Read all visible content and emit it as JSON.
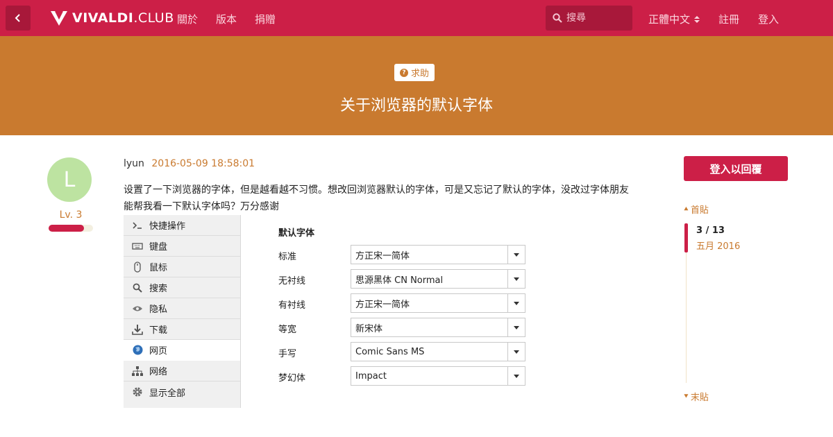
{
  "header": {
    "logo_brand": "VIVALDI",
    "logo_suffix": ".CLUB",
    "nav": [
      "關於",
      "版本",
      "捐贈"
    ],
    "search_placeholder": "搜尋",
    "language": "正體中文",
    "register": "註冊",
    "login": "登入",
    "colors": {
      "bar": "#cc1f47",
      "banner": "#c97a2f"
    }
  },
  "topic": {
    "category": "求助",
    "title": "关于浏览器的默认字体"
  },
  "post": {
    "avatar_letter": "L",
    "level": "Lv. 3",
    "level_progress": 0.8,
    "author": "lyun",
    "date": "2016-05-09 18:58:01",
    "body_line1": "设置了一下浏览器的字体，但是越看越不习惯。想改回浏览器默认的字体，可是又忘记了默认的字体，没改过字体朋友",
    "body_line2": "能帮我看一下默认字体吗？万分感谢"
  },
  "settings": {
    "sidebar": [
      {
        "label": "快捷操作",
        "icon": "quick-commands-icon",
        "active": false
      },
      {
        "label": "键盘",
        "icon": "keyboard-icon",
        "active": false
      },
      {
        "label": "鼠标",
        "icon": "mouse-icon",
        "active": false
      },
      {
        "label": "搜索",
        "icon": "search-icon",
        "active": false
      },
      {
        "label": "隐私",
        "icon": "eye-icon",
        "active": false
      },
      {
        "label": "下载",
        "icon": "download-icon",
        "active": false
      },
      {
        "label": "网页",
        "icon": "globe-icon",
        "active": true
      },
      {
        "label": "网络",
        "icon": "network-icon",
        "active": false
      },
      {
        "label": "显示全部",
        "icon": "gear-icon",
        "active": false
      }
    ],
    "fonts_title": "默认字体",
    "fonts": [
      {
        "label": "标准",
        "value": "方正宋一简体"
      },
      {
        "label": "无衬线",
        "value": "思源黑体 CN Normal"
      },
      {
        "label": "有衬线",
        "value": "方正宋一简体"
      },
      {
        "label": "等宽",
        "value": "新宋体"
      },
      {
        "label": "手写",
        "value": "Comic Sans MS"
      },
      {
        "label": "梦幻体",
        "value": "Impact"
      }
    ]
  },
  "sidebar_right": {
    "reply_button": "登入以回覆",
    "first_post": "首貼",
    "last_post": "末貼",
    "position": "3 / 13",
    "month": "五月 2016"
  }
}
